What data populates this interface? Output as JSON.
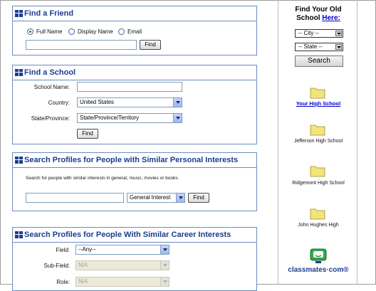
{
  "find_friend": {
    "title": "Find a Friend",
    "options": [
      "Full Name",
      "Display Name",
      "Email"
    ],
    "selected_option": "Full Name",
    "input_value": "",
    "button": "Find"
  },
  "find_school": {
    "title": "Find a School",
    "school_name_label": "School Name:",
    "school_name_value": "",
    "country_label": "Country:",
    "country_value": "United States",
    "state_label": "State/Province:",
    "state_value": "State/Province/Territory",
    "button": "Find"
  },
  "personal_interests": {
    "title": "Search Profiles for People with Similar Personal Interests",
    "description": "Search for people with similar interests in general, music, movies or books.",
    "input_value": "",
    "select_value": "General Interest",
    "button": "Find"
  },
  "career_interests": {
    "title": "Search Profiles for People With Similar Career Interests",
    "field_label": "Field:",
    "field_value": "--Any--",
    "subfield_label": "Sub-Field:",
    "subfield_value": "N/A",
    "role_label": "Role:",
    "role_value": "N/A"
  },
  "sidebar": {
    "heading_line1": "Find Your Old",
    "heading_line2": "School",
    "heading_link": "Here:",
    "city_select": "-- City --",
    "state_select": "-- State --",
    "search_button": "Search",
    "your_high_school": "Your High School",
    "schools": [
      "Jefferson High School",
      "Ridgemont High School",
      "John Hughes High"
    ],
    "logo_text": "classmates·com®"
  },
  "colors": {
    "panel_border": "#6b8cbf",
    "heading_blue": "#1a3d8f",
    "link_blue": "#0000cc",
    "folder_yellow": "#f4e37a",
    "logo_green": "#2fa84a"
  }
}
